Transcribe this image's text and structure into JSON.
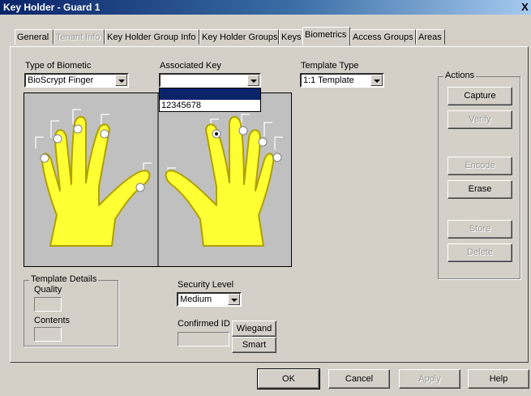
{
  "window": {
    "title": "Key Holder - Guard 1",
    "close_glyph": "X"
  },
  "tabs": [
    {
      "label": "General",
      "state": "normal"
    },
    {
      "label": "Tenant Info",
      "state": "disabled"
    },
    {
      "label": "Key Holder Group Info",
      "state": "normal"
    },
    {
      "label": "Key Holder Groups",
      "state": "normal"
    },
    {
      "label": "Keys",
      "state": "normal"
    },
    {
      "label": "Biometrics",
      "state": "active"
    },
    {
      "label": "Access Groups",
      "state": "normal"
    },
    {
      "label": "Areas",
      "state": "normal"
    }
  ],
  "biometric": {
    "type_label": "Type of Biometic",
    "type_value": "BioScrypt Finger",
    "key_label": "Associated Key",
    "key_value": "",
    "key_options": [
      "",
      "12345678"
    ],
    "template_type_label": "Template Type",
    "template_type_value": "1:1 Template"
  },
  "actions": {
    "title": "Actions",
    "capture": "Capture",
    "verify": "Verify",
    "encode": "Encode",
    "erase": "Erase",
    "store": "Store",
    "delete": "Delete"
  },
  "template_details": {
    "title": "Template Details",
    "quality_label": "Quality",
    "contents_label": "Contents"
  },
  "security": {
    "label": "Security Level",
    "value": "Medium"
  },
  "confirmed": {
    "label": "Confirmed ID",
    "wiegand": "Wiegand",
    "smart": "Smart"
  },
  "footer": {
    "ok": "OK",
    "cancel": "Cancel",
    "apply": "Apply",
    "help": "Help"
  },
  "colors": {
    "hand": "#ffff33",
    "hand_outline": "#b0a000",
    "hand_bg": "#c0c0c0",
    "title_bar": "#0a246a"
  }
}
